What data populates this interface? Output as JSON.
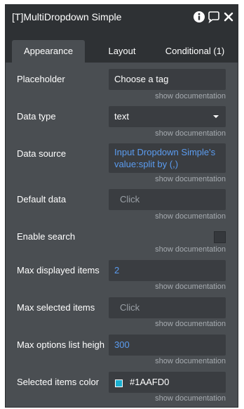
{
  "window": {
    "title": "[T]MultiDropdown Simple",
    "icons": [
      "info-icon",
      "comment-icon",
      "close-icon"
    ]
  },
  "tabs": [
    {
      "label": "Appearance",
      "active": true
    },
    {
      "label": "Layout",
      "active": false
    },
    {
      "label": "Conditional (1)",
      "active": false
    }
  ],
  "doc_link": "show documentation",
  "fields": {
    "placeholder": {
      "label": "Placeholder",
      "value": "Choose a tag"
    },
    "data_type": {
      "label": "Data type",
      "value": "text"
    },
    "data_source": {
      "label": "Data source",
      "value_line1": "Input Dropdown Simple's",
      "value_line2": "value:split by (,)"
    },
    "default_data": {
      "label": "Default data",
      "placeholder": "Click"
    },
    "enable_search": {
      "label": "Enable search",
      "checked": false
    },
    "max_displayed": {
      "label": "Max displayed items",
      "value": "2"
    },
    "max_selected": {
      "label": "Max selected items",
      "placeholder": "Click"
    },
    "max_options_height": {
      "label": "Max options list heigh",
      "value": "300"
    },
    "selected_color": {
      "label": "Selected items color",
      "value": "#1AAFD0",
      "swatch": "#1AAFD0"
    }
  },
  "colors": {
    "panel_bg": "#4a4e52",
    "header_bg": "#2e3134",
    "field_bg": "#3a3d41",
    "link_blue": "#5b9cf0"
  }
}
